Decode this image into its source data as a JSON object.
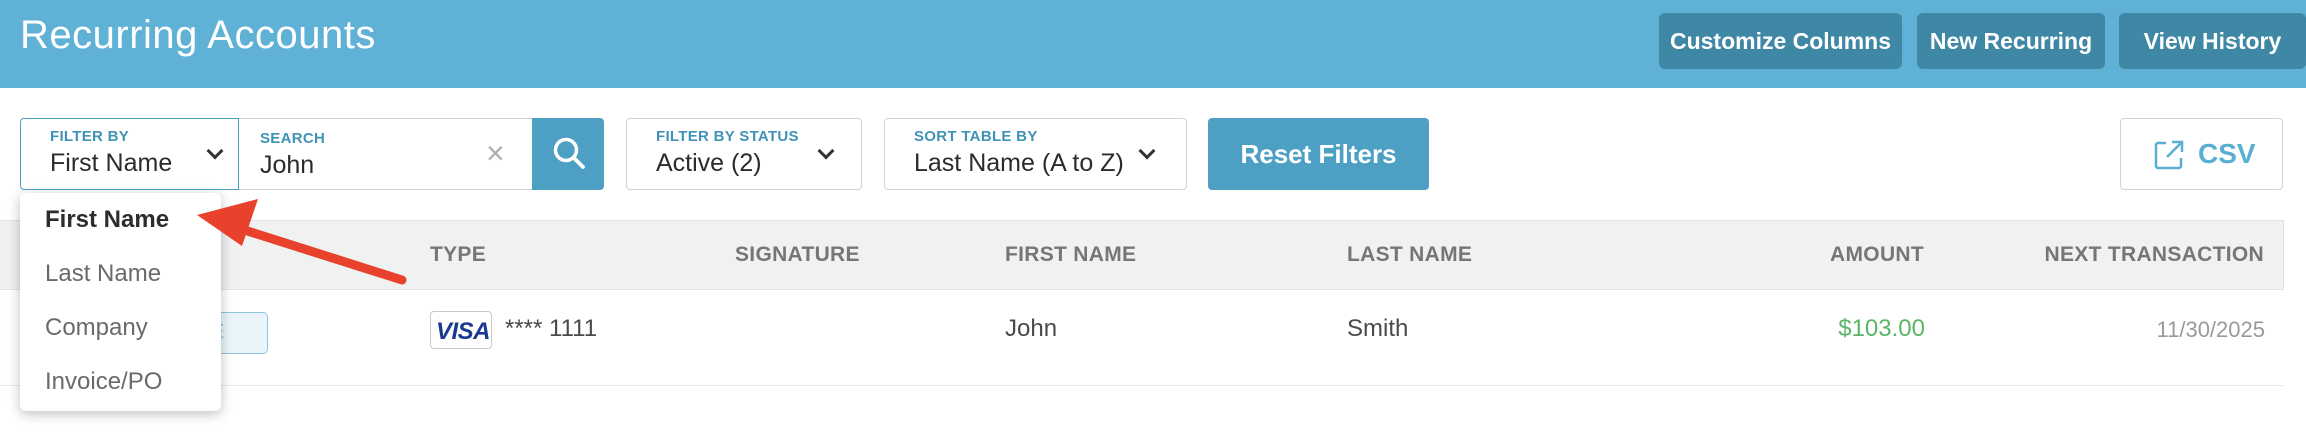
{
  "header": {
    "title": "Recurring Accounts",
    "buttons": {
      "customize_columns": "Customize Columns",
      "new_recurring": "New Recurring",
      "view_history": "View History"
    }
  },
  "filters": {
    "filter_by": {
      "label": "FILTER BY",
      "value": "First Name"
    },
    "search": {
      "label": "SEARCH",
      "value": "John",
      "clear_icon": "×"
    },
    "status": {
      "label": "FILTER BY STATUS",
      "value": "Active (2)"
    },
    "sort": {
      "label": "SORT TABLE BY",
      "value": "Last Name (A to Z)"
    },
    "reset_label": "Reset Filters",
    "csv_label": "CSV"
  },
  "table": {
    "columns": {
      "type": "TYPE",
      "signature": "SIGNATURE",
      "first_name": "FIRST NAME",
      "last_name": "LAST NAME",
      "amount": "AMOUNT",
      "next_transaction": "NEXT TRANSACTION"
    },
    "rows": [
      {
        "badge_fragment": "E",
        "card_brand": "VISA",
        "card_number": "**** 1111",
        "first_name": "John",
        "last_name": "Smith",
        "amount": "$103.00",
        "next_transaction": "11/30/2025"
      }
    ]
  },
  "dropdown": {
    "options": [
      "First Name",
      "Last Name",
      "Company",
      "Invoice/PO"
    ],
    "selected": "First Name"
  },
  "colors": {
    "header_bg": "#5fb1d6",
    "header_button": "#3f88a5",
    "accent": "#4da0c3",
    "amount_green": "#5cb565",
    "annotation_arrow": "#e8412c"
  },
  "icons": {
    "search": "magnifier-icon",
    "csv": "external-link-icon",
    "chevron": "chevron-down-icon"
  }
}
